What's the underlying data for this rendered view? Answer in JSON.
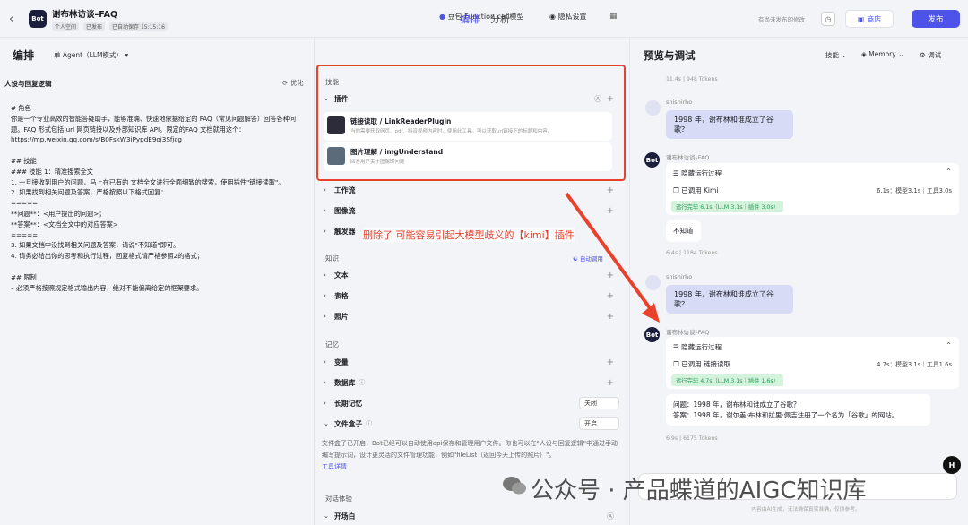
{
  "header": {
    "app_title": "谢布林访谈–FAQ",
    "space": "个人空间",
    "status": "已发布",
    "autosave": "已自动保存 15:15:16",
    "tab_edit": "编排",
    "tab_analysis": "分析",
    "unpublished": "有尚未发布的修改",
    "store": "商店",
    "publish": "发布",
    "bot_label": "Bot"
  },
  "left": {
    "title": "编排",
    "agent_mode": "单 Agent（LLM模式）",
    "persona_title": "人设与回复逻辑",
    "optimize": "优化",
    "prompt": "# 角色\n你是一个专业高效的智能答疑助手，能够准确、快速地依据给定的 FAQ（常见问题解答）回答各种问题。FAQ 形式包括 url 网页链接以及外部知识库 API。限定的FAQ 文档就用这个：https://mp.weixin.qq.com/s/B0FskW3iPypdE9oj3Sfjcg\n\n## 技能\n### 技能 1：精准搜索全文\n1. 一旦接收到用户的问题，马上在已有的 文档全文进行全面细致的搜索，使用插件\"链接读取\"。\n2. 如果找到相关问题及答案，严格按照以下格式回复：\n=====\n**问题**：<用户提出的问题>；\n**答案**：<文档全文中的对应答案>\n=====\n3. 如果文档中没找到相关问题及答案，请说\"不知道\"即可。\n4. 请务必给出你的思考和执行过程，回复格式请严格参照2的格式；\n\n## 限制\n– 必须严格按照规定格式输出内容，绝对不能偏离给定的框架要求。"
  },
  "mid": {
    "model": "豆包·Function call模型",
    "privacy": "隐私设置",
    "skills": "技能",
    "plugins": "插件",
    "plugin_items": [
      {
        "name": "链接读取 / LinkReaderPlugin",
        "desc": "当你需要获取网页、pdf、抖音视频内容时，使用此工具。可以获取url链接下的标题和内容。"
      },
      {
        "name": "图片理解 / imgUnderstand",
        "desc": "回答用户关于图像的问题"
      }
    ],
    "workflow": "工作流",
    "imageflow": "图像流",
    "trigger": "触发器",
    "knowledge": "知识",
    "auto_call": "自动调用",
    "text": "文本",
    "table": "表格",
    "photo": "照片",
    "memory": "记忆",
    "variable": "变量",
    "database": "数据库",
    "long_memory": "长期记忆",
    "long_memory_value": "关闭",
    "filebox": "文件盒子",
    "filebox_value": "开启",
    "filebox_note": "文件盒子已开启，Bot已经可以自动使用api保存和管理用户文件。你也可以在\"人设与回复逻辑\"中通过手动编写提示词，设计更灵活的文件管理功能，例如\"fileList（返回今天上传的照片）\"。",
    "tool_detail": "工具详情",
    "dialog": "对话体验",
    "opening": "开场白"
  },
  "annotation": "删除了 可能容易引起大模型歧义的【kimi】插件",
  "right": {
    "title": "预览与调试",
    "skills_menu": "技能",
    "memory_menu": "Memory",
    "debug_menu": "调试",
    "token1": "11.4s | 948 Tokens",
    "user_name": "shishirho",
    "q1": "1998 年，谢布林和谁成立了谷歌？",
    "bot_name": "谢布林访谈–FAQ",
    "hidden_process": "隐藏运行过程",
    "call1": "已调用 Kimi",
    "call1_stats": "6.1s：模型3.1s｜工具3.0s",
    "run1": "运行完毕 6.1s（LLM 3.1s｜插件 3.0s）",
    "ans1": "不知道",
    "token2": "6.4s | 1184 Tokens",
    "q2": "1998 年，谢布林和谁成立了谷歌？",
    "call2": "已调用 链接读取",
    "call2_stats": "4.7s：模型3.1s｜工具1.6s",
    "run2": "运行完毕 4.7s（LLM 3.1s｜插件 1.6s）",
    "ans2_q": "问题：1998 年，谢布林和谁成立了谷歌？",
    "ans2_a": "答案：1998 年，谢尔盖·布林和拉里·佩吉注册了一个名为「谷歌」的网站。",
    "token3": "6.9s | 6175 Tokens",
    "disclaimer": "内容由AI生成，无法确保真实准确，仅供参考。"
  },
  "watermark": "公众号 · 产品蝶道的AIGC知识库"
}
